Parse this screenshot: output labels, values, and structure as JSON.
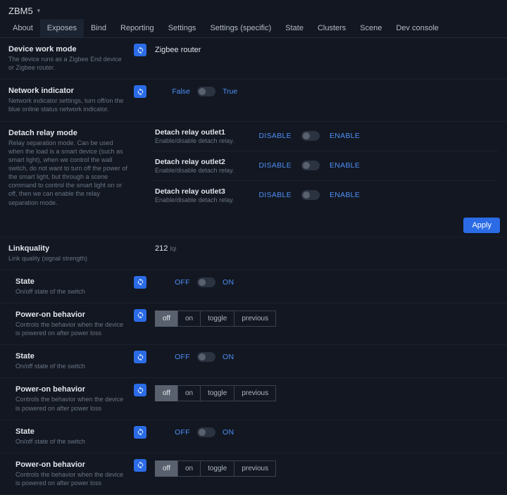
{
  "header": {
    "title": "ZBM5"
  },
  "tabs": [
    "About",
    "Exposes",
    "Bind",
    "Reporting",
    "Settings",
    "Settings (specific)",
    "State",
    "Clusters",
    "Scene",
    "Dev console"
  ],
  "active_tab": 1,
  "apply_label": "Apply",
  "sections": {
    "work_mode": {
      "title": "Device work mode",
      "desc": "The device runs as a Zigbee End device or Zigbee router.",
      "value": "Zigbee router"
    },
    "network_indicator": {
      "title": "Network indicator",
      "desc": "Network indicator settings, turn off/on the blue online status network indicator.",
      "false_label": "False",
      "true_label": "True"
    },
    "detach": {
      "title": "Detach relay mode",
      "desc": "Relay separation mode. Can be used when the load is a smart device (such as smart light), when we control the wall switch, do not want to turn off the power of the smart light, but through a scene command to control the smart light on or off, then we can enable the relay separation mode.",
      "outlets": [
        {
          "title": "Detach relay outlet1",
          "desc": "Enable/disable detach relay.",
          "left": "DISABLE",
          "right": "ENABLE"
        },
        {
          "title": "Detach relay outlet2",
          "desc": "Enable/disable detach relay.",
          "left": "DISABLE",
          "right": "ENABLE"
        },
        {
          "title": "Detach relay outlet3",
          "desc": "Enable/disable detach relay.",
          "left": "DISABLE",
          "right": "ENABLE"
        }
      ]
    },
    "linkquality": {
      "title": "Linkquality",
      "desc": "Link quality (signal strength)",
      "value": "212",
      "unit": "lqi"
    },
    "endpoints": [
      {
        "state": {
          "title": "State",
          "desc": "On/off state of the switch",
          "off": "OFF",
          "on": "ON"
        },
        "pob": {
          "title": "Power-on behavior",
          "desc": "Controls the behavior when the device is powered on after power loss",
          "options": [
            "off",
            "on",
            "toggle",
            "previous"
          ],
          "selected": 0
        }
      },
      {
        "state": {
          "title": "State",
          "desc": "On/off state of the switch",
          "off": "OFF",
          "on": "ON"
        },
        "pob": {
          "title": "Power-on behavior",
          "desc": "Controls the behavior when the device is powered on after power loss",
          "options": [
            "off",
            "on",
            "toggle",
            "previous"
          ],
          "selected": 0
        }
      },
      {
        "state": {
          "title": "State",
          "desc": "On/off state of the switch",
          "off": "OFF",
          "on": "ON"
        },
        "pob": {
          "title": "Power-on behavior",
          "desc": "Controls the behavior when the device is powered on after power loss",
          "options": [
            "off",
            "on",
            "toggle",
            "previous"
          ],
          "selected": 0
        }
      }
    ]
  }
}
